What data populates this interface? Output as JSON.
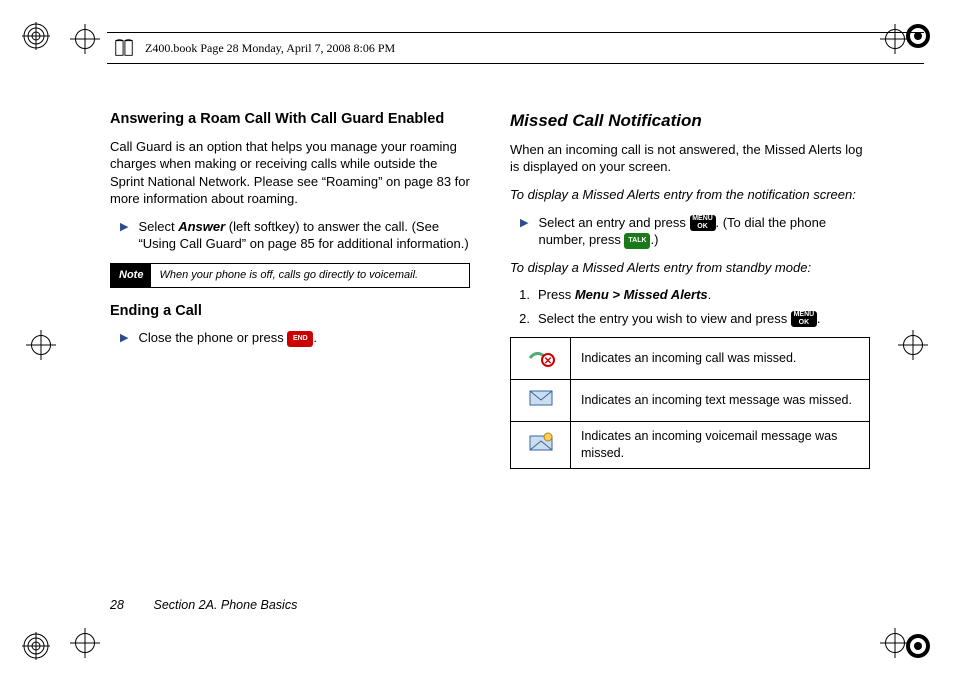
{
  "header": {
    "text": "Z400.book  Page 28  Monday, April 7, 2008  8:06 PM"
  },
  "left": {
    "h1": "Answering a Roam Call With Call Guard Enabled",
    "p1": "Call Guard is an option that helps you manage your roaming charges when making or receiving calls while outside the Sprint National Network. Please see “Roaming” on page 83 for more information about roaming.",
    "bullet1_pre": "Select ",
    "bullet1_answer": "Answer",
    "bullet1_post": " (left softkey) to answer the call. (See “Using Call Guard” on page 85 for additional information.)",
    "note_label": "Note",
    "note_text": "When your phone is off, calls go directly to voicemail.",
    "h2": "Ending a Call",
    "bullet2_pre": "Close the phone or press ",
    "bullet2_post": ".",
    "key_end": "END"
  },
  "right": {
    "h1": "Missed Call Notification",
    "p1": "When an incoming call is not answered, the Missed Alerts log is displayed on your screen.",
    "sub1": "To display a Missed Alerts entry from the notification screen:",
    "bullet1_pre": "Select an entry and press ",
    "bullet1_mid": ". (To dial the phone number, press ",
    "bullet1_post": ".)",
    "sub2": "To display a Missed Alerts entry from standby mode:",
    "step1_pre": "Press ",
    "step1_menu": "Menu > Missed Alerts",
    "step1_post": ".",
    "step2_pre": "Select the entry you wish to view and press ",
    "step2_post": ".",
    "key_menuok_l1": "MENU",
    "key_menuok_l2": "OK",
    "key_talk": "TALK",
    "table": {
      "r1": "Indicates an incoming call was missed.",
      "r2": "Indicates an incoming text message was missed.",
      "r3": "Indicates an incoming voicemail message was missed."
    }
  },
  "footer": {
    "page": "28",
    "section": "Section 2A. Phone Basics"
  }
}
